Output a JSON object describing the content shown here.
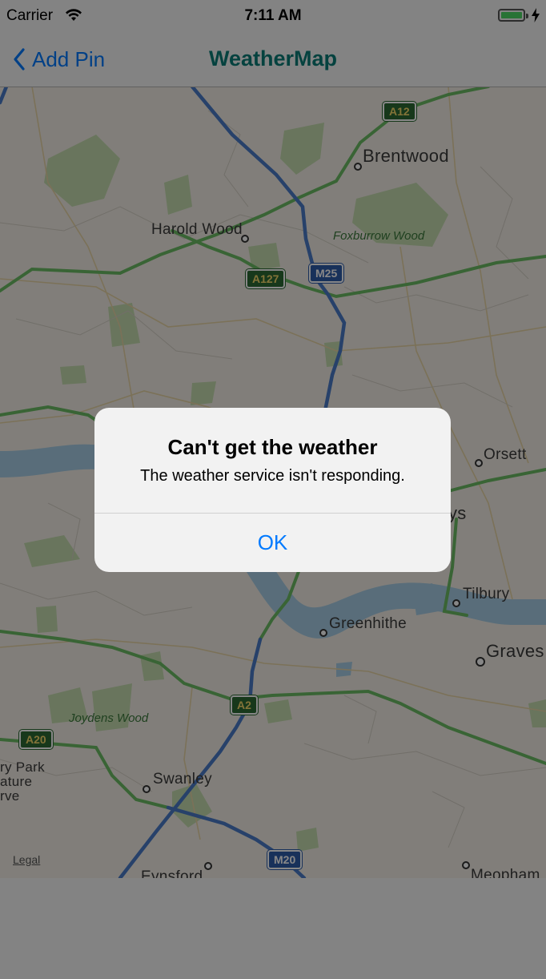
{
  "status_bar": {
    "carrier": "Carrier",
    "time": "7:11 AM",
    "wifi_icon": "wifi-icon",
    "battery_icon": "battery-full-icon",
    "charging_icon": "charging-bolt-icon"
  },
  "nav_bar": {
    "back_label": "Add Pin",
    "back_icon": "chevron-left-icon",
    "title": "WeatherMap",
    "title_color": "#0a7d78",
    "tint_color": "#007aff"
  },
  "map": {
    "places": {
      "brentwood": "Brentwood",
      "harold_wood": "Harold Wood",
      "orsett": "Orsett",
      "thurrock_partial": "ys",
      "tilbury": "Tilbury",
      "greenhithe": "Greenhithe",
      "gravesend_partial": "Graves",
      "swanley": "Swanley",
      "eynsford_partial": "Eynsford",
      "meopham_partial": "Meopham",
      "park_partial_1": "ry Park",
      "park_partial_2": "ature",
      "park_partial_3": "rve"
    },
    "woods": {
      "foxburrow": "Foxburrow Wood",
      "joydens": "Joydens Wood"
    },
    "roads": {
      "a12": "A12",
      "a127": "A127",
      "m25": "M25",
      "a2": "A2",
      "a20": "A20",
      "m20": "M20"
    },
    "legal": "Legal"
  },
  "alert": {
    "title": "Can't get the weather",
    "message": "The weather service isn't responding.",
    "ok_label": "OK"
  }
}
